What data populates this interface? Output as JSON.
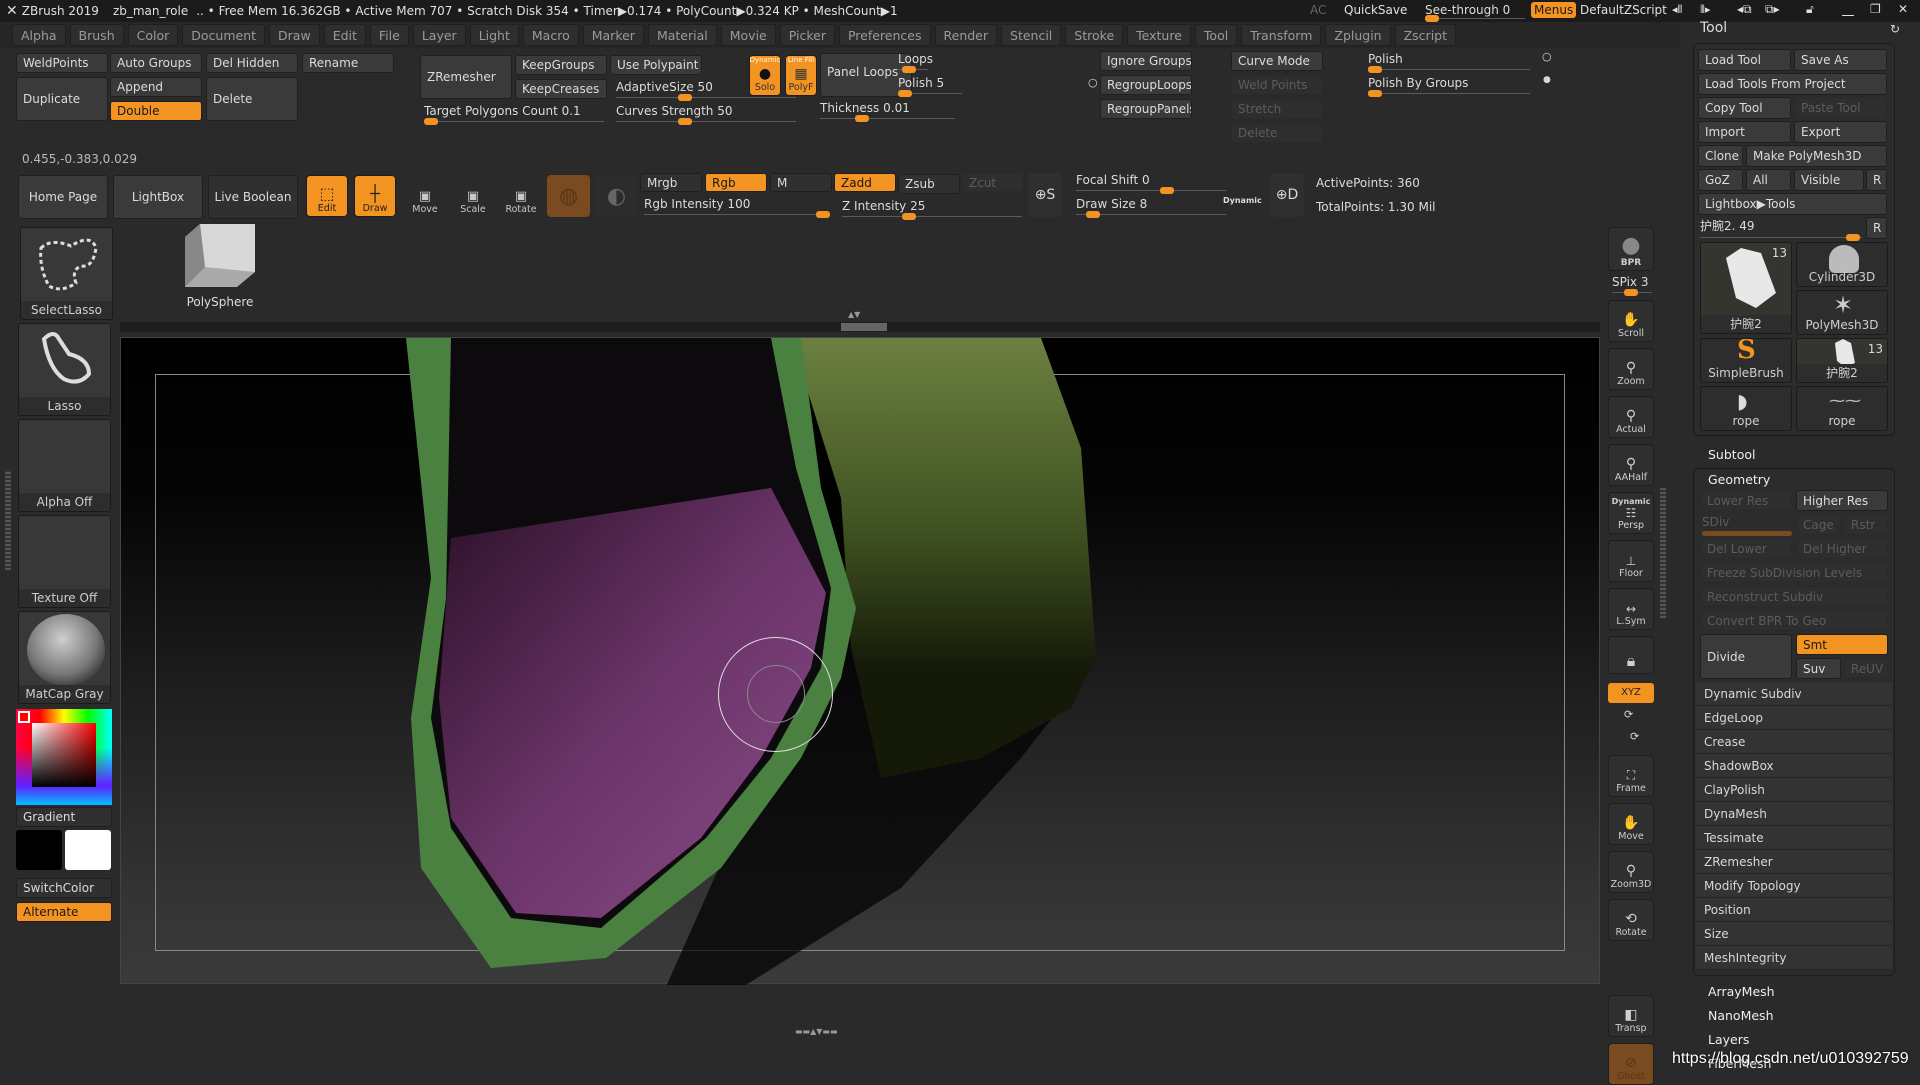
{
  "titlebar": {
    "app": "ZBrush 2019",
    "project": "zb_man_role",
    "status": ".. • Free Mem 16.362GB • Active Mem 707 • Scratch Disk 354 •  Timer▶0.174 • PolyCount▶0.324 KP  • MeshCount▶1",
    "ac": "AC",
    "quicksave": "QuickSave",
    "see_through_label": "See-through  0",
    "see_through_value": 0,
    "menus": "Menus",
    "zscript": "DefaultZScript"
  },
  "menus": [
    "Alpha",
    "Brush",
    "Color",
    "Document",
    "Draw",
    "Edit",
    "File",
    "Layer",
    "Light",
    "Macro",
    "Marker",
    "Material",
    "Movie",
    "Picker",
    "Preferences",
    "Render",
    "Stencil",
    "Stroke",
    "Texture",
    "Tool",
    "Transform",
    "Zplugin",
    "Zscript"
  ],
  "toolbar_top": {
    "weldpoints": "WeldPoints",
    "auto_groups": "Auto Groups",
    "del_hidden": "Del Hidden",
    "rename": "Rename",
    "duplicate": "Duplicate",
    "append": "Append",
    "double": "Double",
    "delete": "Delete",
    "zremesher": "ZRemesher",
    "keepgroups": "KeepGroups",
    "keepcreases": "KeepCreases",
    "target_polygons": "Target Polygons Count 0.1",
    "use_polypaint": "Use Polypaint",
    "adaptive_size": "AdaptiveSize 50",
    "curves_strength": "Curves Strength 50",
    "solo_top": "Dynamic",
    "solo": "Solo",
    "polyf_top": "Line Fill",
    "polyf": "PolyF",
    "panel_loops": "Panel Loops",
    "loops": "Loops",
    "polish5": "Polish 5",
    "thickness": "Thickness 0.01",
    "ignore_groups": "Ignore Groups",
    "regroup_loops": "RegroupLoops",
    "regroup_panels": "RegroupPanels",
    "curve_mode": "Curve Mode",
    "weld_points": "Weld Points",
    "stretch": "Stretch",
    "delete2": "Delete",
    "polish": "Polish",
    "polish_by_groups": "Polish By Groups",
    "coords": "0.455,-0.383,0.029"
  },
  "shelf": {
    "home_page": "Home Page",
    "lightbox": "LightBox",
    "live_boolean": "Live Boolean",
    "edit": "Edit",
    "draw": "Draw",
    "move": "Move",
    "scale": "Scale",
    "rotate": "Rotate",
    "mrgb": "Mrgb",
    "rgb": "Rgb",
    "m": "M",
    "rgb_intensity": "Rgb Intensity 100",
    "zadd": "Zadd",
    "zsub": "Zsub",
    "zcut": "Zcut",
    "z_intensity": "Z Intensity 25",
    "focal_shift": "Focal Shift 0",
    "draw_size": "Draw Size 8",
    "dynamic": "Dynamic",
    "active_points": "ActivePoints: 360",
    "total_points": "TotalPoints: 1.30 Mil"
  },
  "left_tray": {
    "select_lasso": "SelectLasso",
    "polysphere": "PolySphere",
    "lasso": "Lasso",
    "alpha_off": "Alpha Off",
    "texture_off": "Texture Off",
    "matcap": "MatCap Gray",
    "gradient": "Gradient",
    "switch_color": "SwitchColor",
    "alternate": "Alternate",
    "main_color": "#ff0000",
    "secondary_color": "#000000",
    "tertiary_color": "#ffffff"
  },
  "right_shelf": {
    "bpr": "BPR",
    "spix": "SPix 3",
    "scroll": "Scroll",
    "zoom": "Zoom",
    "actual": "Actual",
    "aahalf": "AAHalf",
    "persp_top": "Dynamic",
    "persp": "Persp",
    "floor": "Floor",
    "lsym": "L.Sym",
    "xyz": "XYZ",
    "frame": "Frame",
    "move": "Move",
    "zoom3d": "Zoom3D",
    "rotate": "Rotate",
    "transp": "Transp",
    "ghost": "Ghost"
  },
  "tool_panel": {
    "title": "Tool",
    "load_tool": "Load Tool",
    "save_as": "Save As",
    "load_from_project": "Load Tools From Project",
    "copy_tool": "Copy Tool",
    "paste_tool": "Paste Tool",
    "import": "Import",
    "export": "Export",
    "clone": "Clone",
    "make_polymesh": "Make PolyMesh3D",
    "goz": "GoZ",
    "all": "All",
    "visible": "Visible",
    "r": "R",
    "lightbox_tools": "Lightbox▶Tools",
    "current_tool": "护腕2. 49",
    "thumbs": [
      {
        "label": "护腕2",
        "count": "13"
      },
      {
        "label": "Cylinder3D",
        "count": ""
      },
      {
        "label": "PolyMesh3D",
        "count": ""
      },
      {
        "label": "SimpleBrush",
        "count": ""
      },
      {
        "label": "护腕2",
        "count": "13"
      },
      {
        "label": "rope",
        "count": ""
      },
      {
        "label": "rope",
        "count": ""
      }
    ],
    "subtool": "Subtool",
    "geometry": "Geometry",
    "lower_res": "Lower Res",
    "higher_res": "Higher Res",
    "sdiv": "SDiv",
    "cage": "Cage",
    "rstr": "Rstr",
    "del_lower": "Del Lower",
    "del_higher": "Del Higher",
    "freeze": "Freeze SubDivision Levels",
    "reconstruct": "Reconstruct Subdiv",
    "convert_bpr": "Convert BPR To Geo",
    "divide": "Divide",
    "smt": "Smt",
    "suv": "Suv",
    "reuv": "ReUV",
    "sections": [
      "Dynamic Subdiv",
      "EdgeLoop",
      "Crease",
      "ShadowBox",
      "ClayPolish",
      "DynaMesh",
      "Tessimate",
      "ZRemesher",
      "Modify Topology",
      "Position",
      "Size",
      "MeshIntegrity"
    ],
    "after": [
      "ArrayMesh",
      "NanoMesh",
      "Layers",
      "FiberMesh"
    ]
  },
  "watermark": "https://blog.csdn.net/u010392759"
}
